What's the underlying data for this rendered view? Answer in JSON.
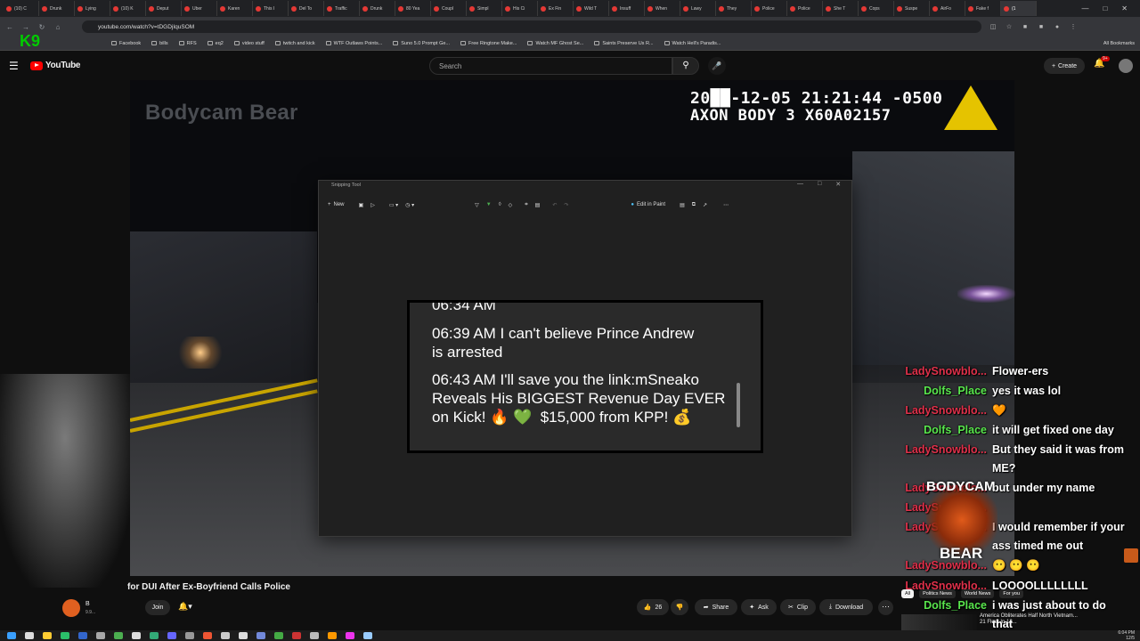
{
  "browser": {
    "tabs": [
      "(10) C",
      "Drunk",
      "Lying",
      "(10) K",
      "Deput",
      "Uber",
      "Karen",
      "This I",
      "Del To",
      "Traffic",
      "Drunk",
      "80 Yea",
      "Coupl",
      "Simpl",
      "His Ci",
      "Ex Fin",
      "Wild T",
      "Insuff",
      "When",
      "Lawy",
      "They",
      "Police",
      "Police",
      "She T",
      "Cops",
      "Suspe",
      "AirFo",
      "Fake f",
      "(1"
    ],
    "active_tab_index": 28,
    "url": "youtube.com/watch?v=tDGDjIquSOM",
    "bookmarks": [
      "Facebook",
      "bills",
      "RFS",
      "eq2",
      "video stuff",
      "twitch and kick",
      "WTF Outlaws Points...",
      "Suno 5.0 Prompt Ge...",
      "Free Ringtone Make...",
      "Watch MF Ghost Se...",
      "Saints Preserve Us R...",
      "Watch Hell's Paradis..."
    ],
    "all_bookmarks": "All Bookmarks"
  },
  "youtube": {
    "logo_text": "YouTube",
    "search_placeholder": "Search",
    "create_label": "Create",
    "notif_count": "9+"
  },
  "video": {
    "watermark": "Bodycam Bear",
    "timestamp_line1": "20██-12-05 21:21:44 -0500",
    "timestamp_line2": "AXON BODY 3 X60A02157",
    "overlay_channel_badge": "K9"
  },
  "snipping_tool": {
    "title": "Snipping Tool",
    "new_label": "New",
    "edit_in_paint": "Edit in Paint",
    "image_lines": [
      "06:34 AM",
      "06:39 AM I can't believe Prince Andrew",
      "is arrested",
      "",
      "06:43 AM I'll save you the link:mSneako",
      "Reveals His BIGGEST Revenue Day EVER",
      "on Kick! 🔥 💚  $15,000 from KPP! 💰"
    ]
  },
  "chat": [
    {
      "name": "LadySnowblo...",
      "color": "#e0304a",
      "msg": "Flower-ers"
    },
    {
      "name": "Dolfs_Place",
      "color": "#59e64d",
      "msg": "yes it was lol"
    },
    {
      "name": "LadySnowblo...",
      "color": "#e0304a",
      "msg": "🧡"
    },
    {
      "name": "Dolfs_Place",
      "color": "#59e64d",
      "msg": "it will get fixed one day"
    },
    {
      "name": "LadySnowblo...",
      "color": "#e0304a",
      "msg": "But they said it was from"
    },
    {
      "name": "",
      "color": "#e0304a",
      "msg": "ME?"
    },
    {
      "name": "LadySnowblo...",
      "color": "#e0304a",
      "msg": "but under my name"
    },
    {
      "name": "LadySnowblo...",
      "color": "#e0304a",
      "msg": ""
    },
    {
      "name": "LadySnowblo...",
      "color": "#e0304a",
      "msg": "I would remember if your"
    },
    {
      "name": "",
      "color": "#e0304a",
      "msg": "ass timed me out"
    },
    {
      "name": "LadySnowblo...",
      "color": "#e0304a",
      "msg": "😶 😶 😶"
    },
    {
      "name": "LadySnowblo...",
      "color": "#e0304a",
      "msg": "LOOOOLLLLLLLL"
    },
    {
      "name": "Dolfs_Place",
      "color": "#59e64d",
      "msg": "i was just about to do"
    },
    {
      "name": "",
      "color": "#e0304a",
      "msg": "that"
    }
  ],
  "bear_logo": {
    "top": "BODYCAM",
    "bottom": "BEAR"
  },
  "info": {
    "title": "for DUI After Ex-Boyfriend Calls Police",
    "channel": "B",
    "subs": "9.9...",
    "join": "Join",
    "likes": "26",
    "share": "Share",
    "ask": "Ask",
    "clip": "Clip",
    "download": "Download"
  },
  "recs": {
    "chips": [
      "All",
      "Politics News",
      "World News",
      "For you"
    ],
    "title": "America Obliterates Half North Vietnam... 21 Fleet In 12..."
  },
  "taskbar": {
    "time": "6:04 PM",
    "date": "12/5"
  }
}
